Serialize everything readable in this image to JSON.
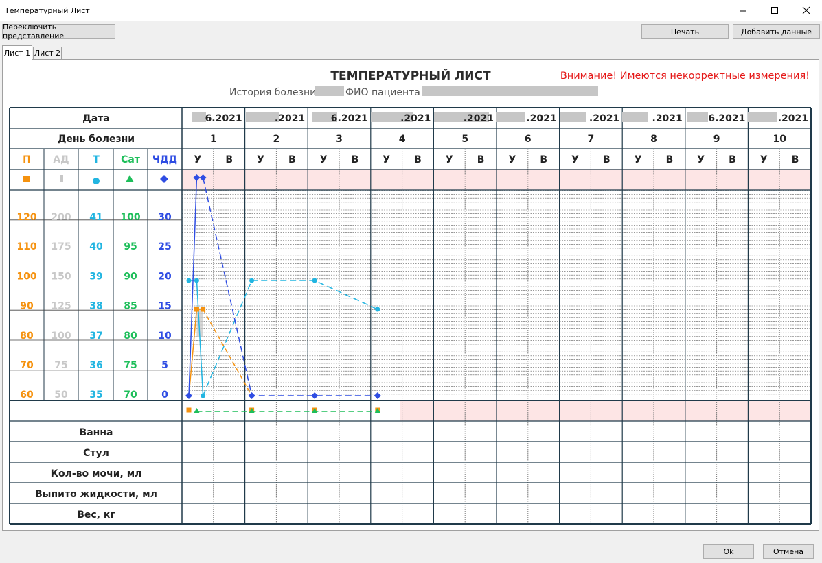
{
  "window": {
    "title": "Температурный Лист"
  },
  "toolbar": {
    "switch_view": "Переключить представление",
    "print": "Печать",
    "add_data": "Добавить данные"
  },
  "tabs": [
    "Лист 1",
    "Лист 2"
  ],
  "sheet": {
    "title": "ТЕМПЕРАТУРНЫЙ ЛИСТ",
    "warning": "Внимание! Имеются некорректные измерения!",
    "history_label": "История болезни",
    "patient_label": "ФИО пациента"
  },
  "grid": {
    "date_label": "Дата",
    "day_label": "День болезни",
    "dates": [
      "6.2021",
      ".2021",
      "6.2021",
      ".2021",
      ".2021",
      ".2021",
      ".2021",
      ".2021",
      "6.2021",
      ".2021"
    ],
    "days": [
      "1",
      "2",
      "3",
      "4",
      "5",
      "6",
      "7",
      "8",
      "9",
      "10"
    ],
    "morning": "У",
    "evening": "В",
    "bottom_rows": [
      "Ванна",
      "Стул",
      "Кол-во мочи, мл",
      "Выпито жидкости, мл",
      "Вес, кг"
    ]
  },
  "scales": {
    "headers": [
      "П",
      "АД",
      "Т",
      "Сат",
      "ЧДД"
    ],
    "colors": [
      "#f5920f",
      "#c8c8c8",
      "#22b5e1",
      "#1ebe5a",
      "#2f4de3"
    ],
    "columns": [
      [
        "120",
        "110",
        "100",
        "90",
        "80",
        "70",
        "60"
      ],
      [
        "200",
        "175",
        "150",
        "125",
        "100",
        "75",
        "50"
      ],
      [
        "41",
        "40",
        "39",
        "38",
        "37",
        "36",
        "35"
      ],
      [
        "100",
        "95",
        "90",
        "85",
        "80",
        "75",
        "70"
      ],
      [
        "30",
        "25",
        "20",
        "15",
        "10",
        "5",
        "0"
      ]
    ]
  },
  "chart_data": {
    "type": "line",
    "series": [
      {
        "name": "П",
        "color": "#f5920f",
        "points": [
          [
            0,
            60
          ],
          [
            0.25,
            90
          ],
          [
            0.45,
            90
          ],
          [
            2,
            60
          ],
          [
            4,
            60
          ],
          [
            6,
            60
          ]
        ]
      },
      {
        "name": "АД",
        "color": "#c8c8c8",
        "points": [
          [
            0.25,
            125
          ],
          [
            0.45,
            125
          ],
          [
            0.45,
            100
          ],
          [
            0.25,
            100
          ]
        ]
      },
      {
        "name": "Т",
        "color": "#22b5e1",
        "points": [
          [
            0,
            39
          ],
          [
            0.25,
            39
          ],
          [
            0.45,
            35
          ],
          [
            2,
            39
          ],
          [
            4,
            39
          ],
          [
            6,
            38
          ]
        ]
      },
      {
        "name": "ЧДД",
        "color": "#2f4de3",
        "points": [
          [
            0,
            0
          ],
          [
            0.25,
            30
          ],
          [
            0.45,
            30
          ],
          [
            2,
            0
          ],
          [
            4,
            0
          ],
          [
            6,
            0
          ]
        ]
      }
    ]
  },
  "footer": {
    "ok": "Ok",
    "cancel": "Отмена"
  }
}
